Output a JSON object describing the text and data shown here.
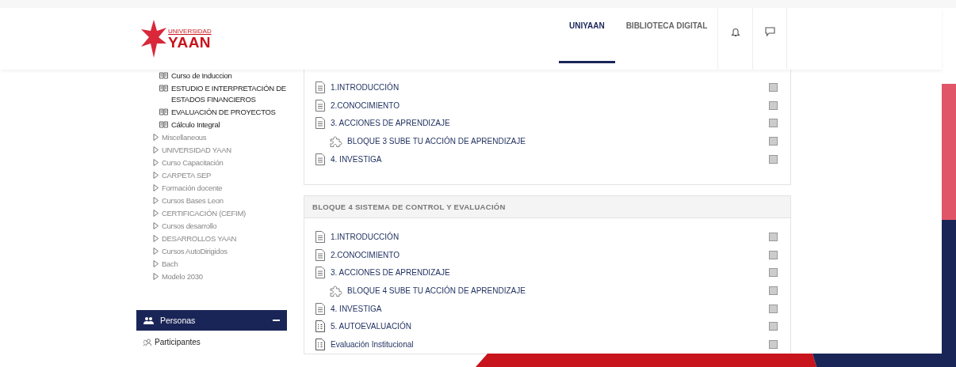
{
  "header": {
    "logo": {
      "line1": "UNIVERSIDAD",
      "line2": "YAAN"
    },
    "nav": [
      {
        "label": "UNIYAAN",
        "selected": true
      },
      {
        "label": "BIBLIOTECA DIGITAL",
        "selected": false
      }
    ]
  },
  "sidebar": {
    "tree": [
      {
        "kind": "course",
        "label": "Curso de Induccion"
      },
      {
        "kind": "course",
        "label": "ESTUDIO E INTERPRETACIÓN DE ESTADOS FINANCIEROS"
      },
      {
        "kind": "course",
        "label": "EVALUACIÓN DE PROYECTOS"
      },
      {
        "kind": "course",
        "label": "Cálculo Integral"
      },
      {
        "kind": "category",
        "label": "Miscellaneous",
        "expanded": false
      },
      {
        "kind": "category",
        "label": "UNIVERSIDAD YAAN",
        "expanded": false
      },
      {
        "kind": "category",
        "label": "Curso Capacitación",
        "expanded": false
      },
      {
        "kind": "category",
        "label": "CARPETA SEP",
        "expanded": false
      },
      {
        "kind": "category",
        "label": "Formación docente",
        "expanded": false
      },
      {
        "kind": "category",
        "label": "Cursos Bases Leon",
        "expanded": false
      },
      {
        "kind": "category",
        "label": "CERTIFICACIÓN (CEFIM)",
        "expanded": false
      },
      {
        "kind": "category",
        "label": "Cursos desarrollo",
        "expanded": false
      },
      {
        "kind": "category",
        "label": "DESARROLLOS YAAN",
        "expanded": false
      },
      {
        "kind": "category",
        "label": "Cursos AutoDirigidos",
        "expanded": false
      },
      {
        "kind": "category",
        "label": "Bach",
        "expanded": false
      },
      {
        "kind": "category",
        "label": "Modelo 2030",
        "expanded": false
      }
    ],
    "block": {
      "title": "Personas",
      "expanded": true,
      "links": [
        "Participantes"
      ]
    }
  },
  "sections": [
    {
      "items": [
        {
          "kind": "page",
          "label": "1.INTRODUCCIÓN",
          "completed": false
        },
        {
          "kind": "page",
          "label": "2.CONOCIMIENTO",
          "completed": false
        },
        {
          "kind": "page",
          "label": "3. ACCIONES DE APRENDIZAJE",
          "completed": false
        },
        {
          "kind": "assignment",
          "label": "BLOQUE 3 SUBE TU ACCIÓN DE APRENDIZAJE",
          "completed": false
        },
        {
          "kind": "page",
          "label": "4. INVESTIGA",
          "completed": false
        }
      ]
    },
    {
      "title": "BLOQUE 4 SISTEMA DE CONTROL Y EVALUACIÓN",
      "items": [
        {
          "kind": "page",
          "label": "1.INTRODUCCIÓN",
          "completed": false
        },
        {
          "kind": "page",
          "label": "2.CONOCIMIENTO",
          "completed": false
        },
        {
          "kind": "page",
          "label": "3. ACCIONES DE APRENDIZAJE",
          "completed": false
        },
        {
          "kind": "assignment",
          "label": "BLOQUE 4 SUBE TU ACCIÓN DE APRENDIZAJE",
          "completed": false
        },
        {
          "kind": "page",
          "label": "4. INVESTIGA",
          "completed": false
        },
        {
          "kind": "quiz",
          "label": "5. AUTOEVALUACIÓN",
          "completed": false
        },
        {
          "kind": "quiz",
          "label": "Evaluación Institucional",
          "completed": false
        }
      ]
    }
  ]
}
